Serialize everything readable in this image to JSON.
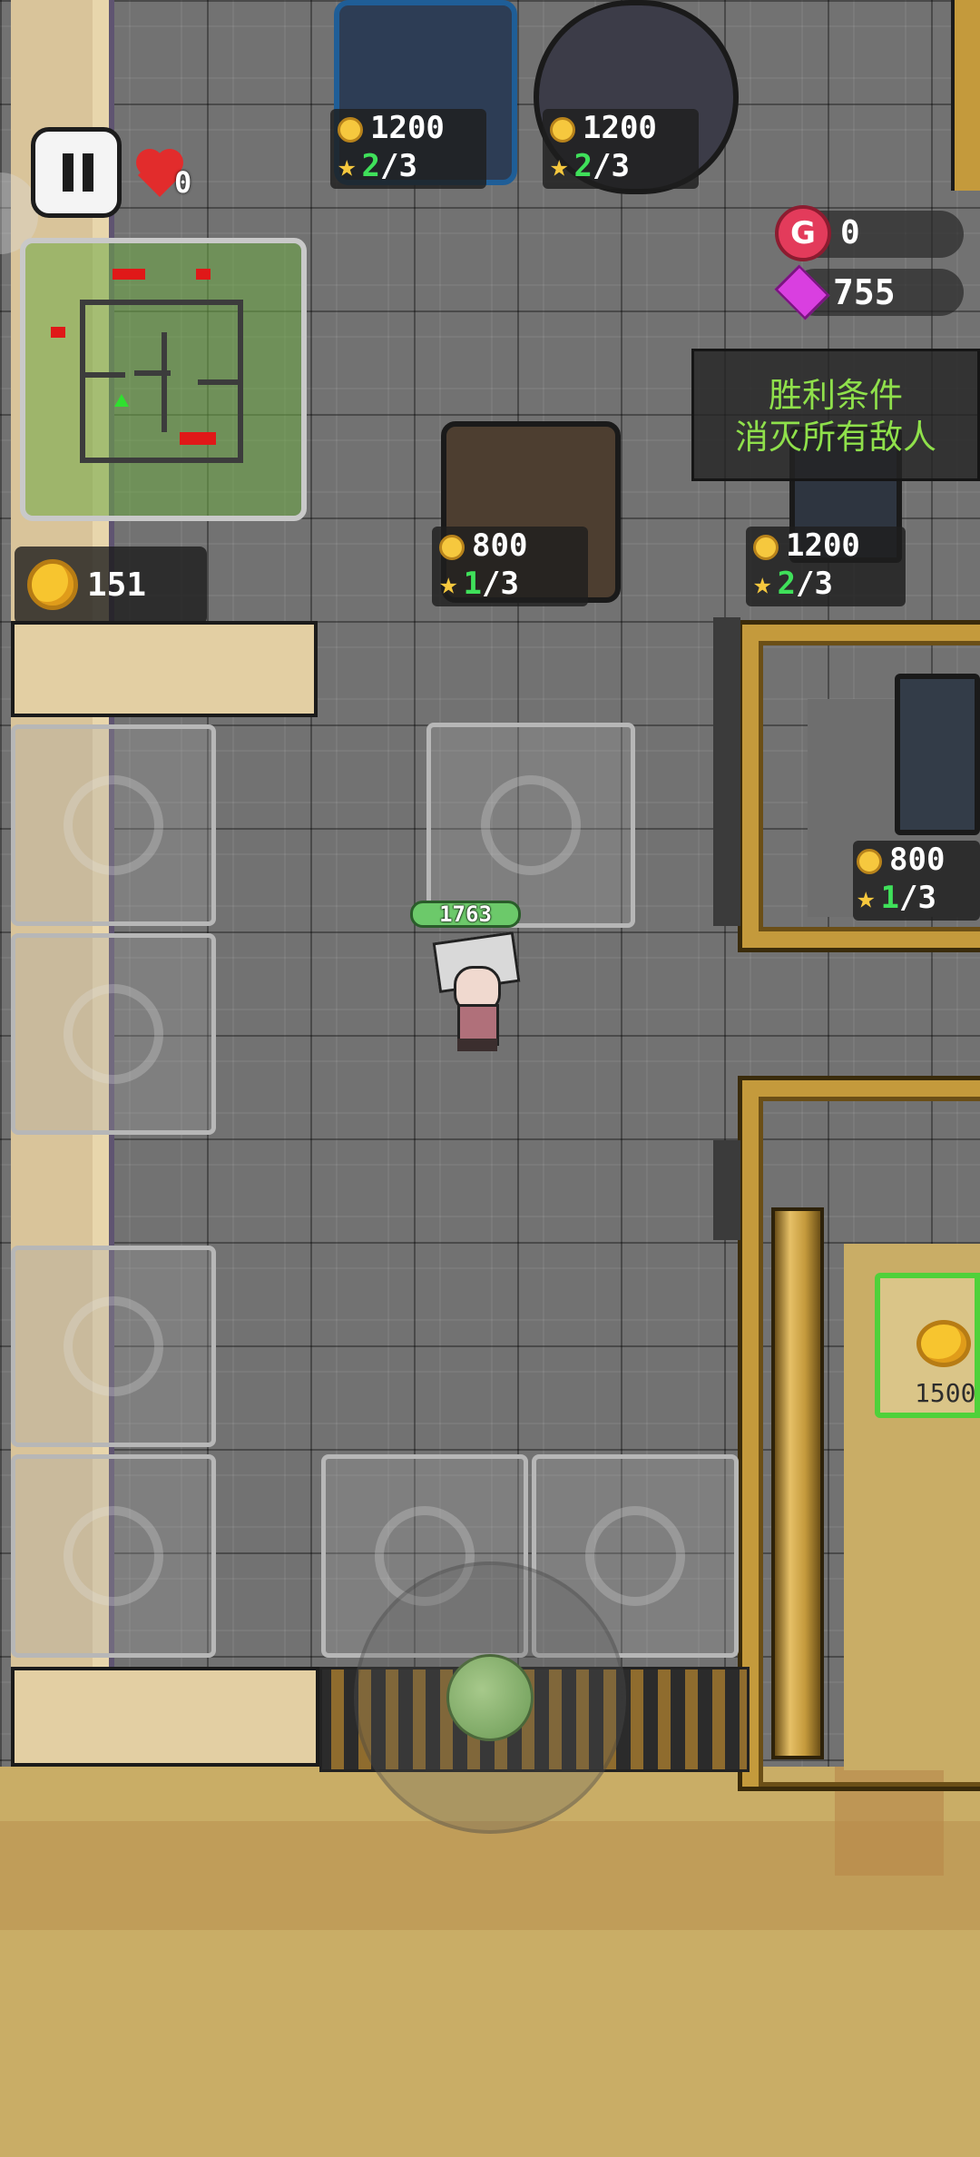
{
  "hud": {
    "lives": "0",
    "coins": "151",
    "g_currency": "0",
    "gems": "755",
    "objective_title": "胜利条件",
    "objective_text": "消灭所有敌人"
  },
  "player": {
    "hp": "1763"
  },
  "shop": [
    {
      "id": "machine-top-1",
      "price": "1200",
      "level": "2",
      "max": "3"
    },
    {
      "id": "machine-top-2",
      "price": "1200",
      "level": "2",
      "max": "3"
    },
    {
      "id": "machine-mid",
      "price": "800",
      "level": "1",
      "max": "3"
    },
    {
      "id": "machine-right",
      "price": "1200",
      "level": "2",
      "max": "3"
    },
    {
      "id": "machine-right-lower",
      "price": "800",
      "level": "1",
      "max": "3"
    }
  ],
  "cart": {
    "price": "1500"
  },
  "colors": {
    "coin": "#f6c83e",
    "level_green": "#3fe05a",
    "objective_green": "#8fe04b",
    "gem": "#d93fe0",
    "g_badge": "#e33b5b"
  },
  "icons": [
    "pause-icon",
    "heart-icon",
    "coin-icon",
    "g-coin-icon",
    "gem-icon",
    "star-icon",
    "trap-icon"
  ]
}
